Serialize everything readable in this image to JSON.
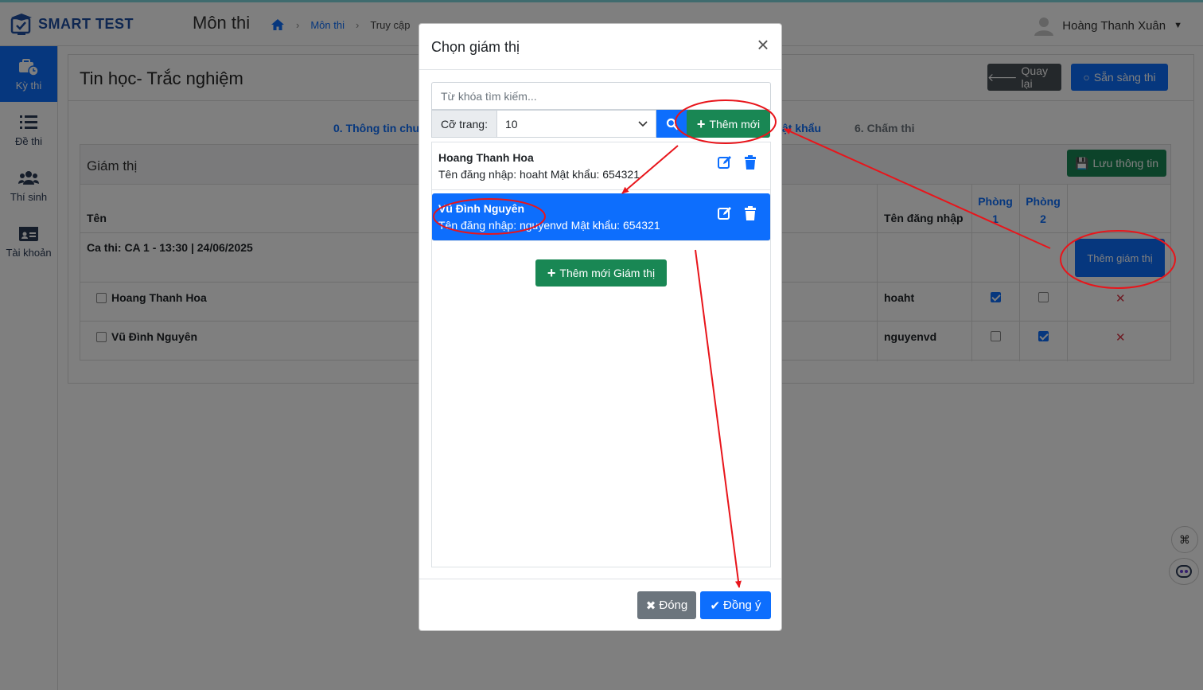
{
  "app": {
    "brand": "SMART TEST",
    "page_heading": "Môn thi",
    "breadcrumb": {
      "link": "Môn thi",
      "current": "Truy cập"
    },
    "user_name": "Hoàng Thanh Xuân"
  },
  "sidebar": {
    "items": [
      {
        "label": "Kỳ thi",
        "icon": "briefcase-clock-icon",
        "active": true
      },
      {
        "label": "Đề thi",
        "icon": "list-icon",
        "active": false
      },
      {
        "label": "Thí sinh",
        "icon": "users-icon",
        "active": false
      },
      {
        "label": "Tài khoản",
        "icon": "id-card-icon",
        "active": false
      }
    ]
  },
  "main": {
    "title": "Tin học- Trắc nghiệm",
    "back_label": "Quay lại",
    "ready_label": "Sẵn sàng thi",
    "steps": {
      "step0": "0. Thông tin chu",
      "step5": "ật khẩu",
      "step6": "6. Chấm thi"
    },
    "panel": {
      "title": "Giám thị",
      "save_label": "Lưu thông tin",
      "col_name": "Tên",
      "col_login": "Tên đăng nhập",
      "col_room1": [
        "Phòng",
        "1"
      ],
      "col_room2": [
        "Phòng",
        "2"
      ],
      "shift": "Ca thi: CA 1 - 13:30 | 24/06/2025",
      "add_invigilator_label": "Thêm giám thị",
      "rows": [
        {
          "name": "Hoang Thanh Hoa",
          "login": "hoaht",
          "room1": true,
          "room2": false
        },
        {
          "name": "Vũ Đình Nguyên",
          "login": "nguyenvd",
          "room1": false,
          "room2": true
        }
      ]
    }
  },
  "modal": {
    "title": "Chọn giám thị",
    "search_placeholder": "Từ khóa tìm kiếm...",
    "page_size_label": "Cỡ trang:",
    "page_size_value": "10",
    "add_new_label": "Thêm mới",
    "items": [
      {
        "name": "Hoang Thanh Hoa",
        "info": "Tên đăng nhập: hoaht Mật khẩu: 654321",
        "selected": false
      },
      {
        "name": "Vũ Đình Nguyên",
        "info": "Tên đăng nhập: nguyenvd Mật khẩu: 654321",
        "selected": true
      }
    ],
    "add_invigilator_label": "Thêm mới Giám thị",
    "close_label": "Đóng",
    "ok_label": "Đồng ý"
  },
  "colors": {
    "primary": "#0d6efd",
    "success": "#198754",
    "secondary": "#6c757d",
    "dark": "#495057",
    "danger": "#dc3545",
    "annotation": "#e8151b"
  }
}
